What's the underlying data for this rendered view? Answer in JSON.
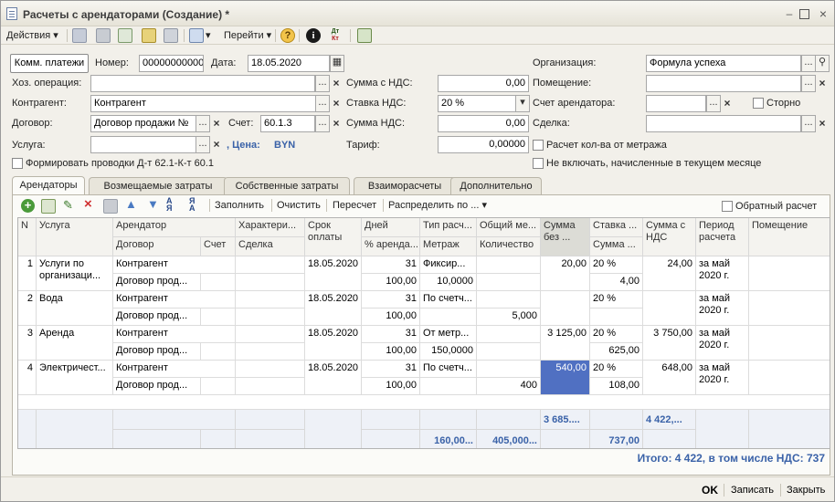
{
  "window": {
    "title": "Расчеты с арендаторами (Создание) *"
  },
  "toolbar": {
    "actions_label": "Действия",
    "goto_label": "Перейти",
    "dtkt_top": "Дт",
    "dtkt_bottom": "Кт"
  },
  "header": {
    "type_button": "Комм. платежи",
    "number_label": "Номер:",
    "number_value": "000000000000",
    "date_label": "Дата:",
    "date_value": "18.05.2020",
    "org_label": "Организация:",
    "org_value": "Формула успеха",
    "hoz_label": "Хоз. операция:",
    "hoz_value": "",
    "sum_vat_label": "Сумма с НДС:",
    "sum_vat_value": "0,00",
    "room_label": "Помещение:",
    "room_value": "",
    "contragent_label": "Контрагент:",
    "contragent_value": "Контрагент",
    "vat_rate_label": "Ставка НДС:",
    "vat_rate_value": "20 %",
    "tenant_account_label": "Счет арендатора:",
    "tenant_account_value": "",
    "storno_label": "Сторно",
    "contract_label": "Договор:",
    "contract_value": "Договор  продажи №",
    "account_label": "Счет:",
    "account_value": "60.1.3",
    "vat_sum_label": "Сумма НДС:",
    "vat_sum_value": "0,00",
    "deal_label": "Сделка:",
    "deal_value": "",
    "service_label": "Услуга:",
    "service_value": "",
    "price_label": ", Цена:",
    "price_currency": "BYN",
    "tariff_label": "Тариф:",
    "tariff_value": "0,00000",
    "meter_calc_label": "Расчет кол-ва от метража",
    "posting_label": "Формировать проводки Д-т 62.1-К-т 60.1",
    "exclude_label": "Не включать, начисленные в текущем месяце"
  },
  "tabs": [
    {
      "label": "Арендаторы",
      "active": true
    },
    {
      "label": "Возмещаемые затраты",
      "active": false
    },
    {
      "label": "Собственные затраты",
      "active": false
    },
    {
      "label": "Взаиморасчеты",
      "active": false
    },
    {
      "label": "Дополнительно",
      "active": false
    }
  ],
  "grid_toolbar": {
    "fill": "Заполнить",
    "clear": "Очистить",
    "recalc": "Пересчет",
    "distribute": "Распределить по ...",
    "reverse_calc": "Обратный расчет"
  },
  "columns": {
    "n": "N",
    "service": "Услуга",
    "tenant": "Арендатор",
    "contract": "Договор",
    "account": "Счет",
    "characteristic": "Характери...",
    "deal": "Сделка",
    "due": "Срок оплаты",
    "days": "Дней",
    "rent_pct": "% аренда...",
    "calc_type": "Тип расч...",
    "area": "Метраж",
    "total_m": "Общий ме...",
    "qty": "Количество",
    "sum_no_vat": "Сумма без ...",
    "vat_rate": "Ставка ...",
    "vat_sum": "Сумма ...",
    "sum_vat": "Сумма с НДС",
    "period": "Период расчета",
    "room": "Помещение"
  },
  "rows": [
    {
      "n": "1",
      "service": "Услуги по организаци...",
      "tenant": "Контрагент",
      "contract": "Договор прод...",
      "due": "18.05.2020",
      "days": "31",
      "pct": "100,00",
      "type": "Фиксир...",
      "area": "10,0000",
      "qty": "",
      "sum": "20,00",
      "rate": "20 %",
      "vat": "4,00",
      "sumvat": "24,00",
      "period": "за май 2020 г."
    },
    {
      "n": "2",
      "service": "Вода",
      "tenant": "Контрагент",
      "contract": "Договор прод...",
      "due": "18.05.2020",
      "days": "31",
      "pct": "100,00",
      "type": "По счетч...",
      "area": "",
      "qty": "5,000",
      "sum": "",
      "rate": "20 %",
      "vat": "",
      "sumvat": "",
      "period": "за май 2020 г."
    },
    {
      "n": "3",
      "service": "Аренда",
      "tenant": "Контрагент",
      "contract": "Договор прод...",
      "due": "18.05.2020",
      "days": "31",
      "pct": "100,00",
      "type": "От метр...",
      "area": "150,0000",
      "qty": "",
      "sum": "3 125,00",
      "rate": "20 %",
      "vat": "625,00",
      "sumvat": "3 750,00",
      "period": "за май 2020 г."
    },
    {
      "n": "4",
      "service": "Электричест...",
      "tenant": "Контрагент",
      "contract": "Договор прод...",
      "due": "18.05.2020",
      "days": "31",
      "pct": "100,00",
      "type": "По счетч...",
      "area": "",
      "qty": "400",
      "sum": "540,00",
      "rate": "20 %",
      "vat": "108,00",
      "sumvat": "648,00",
      "period": "за май 2020 г."
    }
  ],
  "footer": {
    "sum": "3 685....",
    "sumvat": "4 422,...",
    "area": "160,00...",
    "qty": "405,000...",
    "vat": "737,00"
  },
  "total_text": "Итого: 4 422, в том числе НДС: 737",
  "buttons": {
    "ok": "OK",
    "save": "Записать",
    "close": "Закрыть"
  }
}
